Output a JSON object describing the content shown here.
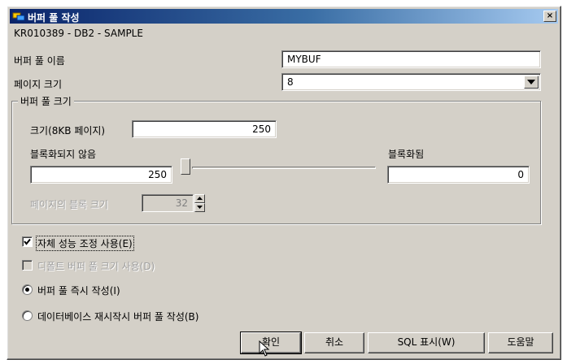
{
  "window": {
    "title": "버퍼 풀 작성",
    "close_label": "×"
  },
  "subtitle": "KR010389 - DB2 - SAMPLE",
  "fields": {
    "name_label": "버퍼 풀 이름",
    "name_value": "MYBUF",
    "page_size_label": "페이지 크기",
    "page_size_value": "8"
  },
  "group": {
    "legend": "버퍼 풀 크기",
    "size_label": "크기(8KB 페이지)",
    "size_value": "250",
    "non_blocked_label": "블록화되지 않음",
    "non_blocked_value": "250",
    "blocked_label": "블록화됨",
    "blocked_value": "0",
    "block_size_label": "페이지의 블록 크기",
    "block_size_value": "32"
  },
  "options": {
    "self_tuning": {
      "label": "자체 성능 조정 사용(E)",
      "checked": true
    },
    "default_size": {
      "label": "디폴트 버퍼 풀 크기 사용(D)",
      "checked": false,
      "disabled": true
    },
    "create_now": {
      "label": "버퍼 풀 즉시 작성(I)",
      "selected": true
    },
    "create_on_restart": {
      "label": "데이터베이스 재시작시 버퍼 풀 작성(B)",
      "selected": false
    }
  },
  "buttons": {
    "ok": "확인",
    "cancel": "취소",
    "show_sql": "SQL 표시(W)",
    "help": "도움말"
  },
  "slider": {
    "blocked_fraction": 0
  }
}
